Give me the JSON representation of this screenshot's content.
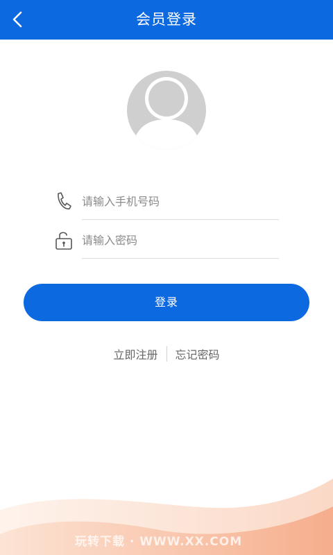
{
  "header": {
    "title": "会员登录",
    "back_icon": "chevron-left-icon",
    "background_color": "#0c69e0"
  },
  "avatar": {
    "icon": "user-avatar-icon"
  },
  "form": {
    "phone": {
      "icon": "phone-icon",
      "placeholder": "请输入手机号码",
      "value": ""
    },
    "password": {
      "icon": "lock-open-icon",
      "placeholder": "请输入密码",
      "value": ""
    }
  },
  "login_button": {
    "label": "登录",
    "color": "#0c69e0"
  },
  "links": {
    "register": "立即注册",
    "forgot_password": "忘记密码"
  },
  "watermark": "玩转下载 · WWW.XX.COM"
}
